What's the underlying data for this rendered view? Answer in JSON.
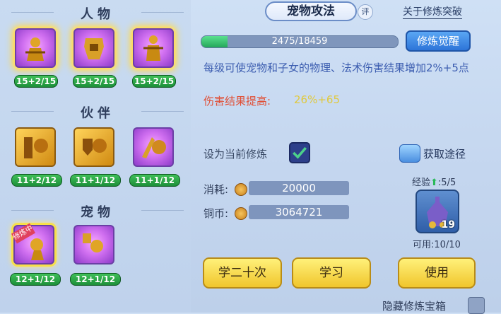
{
  "left": {
    "sections": [
      {
        "title": "人物",
        "slots": [
          {
            "level": "15+2/15"
          },
          {
            "level": "15+2/15"
          },
          {
            "level": "15+2/15"
          }
        ]
      },
      {
        "title": "伙伴",
        "slots": [
          {
            "level": "11+2/12"
          },
          {
            "level": "11+1/12"
          },
          {
            "level": "11+1/12"
          }
        ]
      },
      {
        "title": "宠物",
        "slots": [
          {
            "level": "12+1/12",
            "badge": "修炼中"
          },
          {
            "level": "12+1/12"
          }
        ]
      }
    ]
  },
  "header": {
    "tab": "宠物攻法",
    "ping": "评",
    "link": "关于修炼突破"
  },
  "progress": {
    "text": "2475/18459",
    "value": 2475,
    "max": 18459
  },
  "awaken_button": "修炼觉醒",
  "description": "每级可使宠物和子女的物理、法术伤害结果增加2%+5点",
  "bonus": {
    "label": "伤害结果提高:",
    "value": "26%+65"
  },
  "set_current": {
    "label": "设为当前修炼",
    "checked": true
  },
  "get_path": "获取途径",
  "cost": {
    "label": "消耗:",
    "value": "20000"
  },
  "copper": {
    "label": "铜币:",
    "value": "3064721"
  },
  "buttons": {
    "learn20": "学二十次",
    "learn": "学习",
    "use": "使用"
  },
  "exp": {
    "label": "经验",
    "value": ":5/5"
  },
  "item": {
    "count": "19",
    "available": "可用:10/10"
  },
  "hide_box": {
    "label": "隐藏修炼宝箱"
  },
  "colors": {
    "accent": "#2d74d8",
    "yellow": "#f0c52c",
    "green": "#25a85a"
  }
}
